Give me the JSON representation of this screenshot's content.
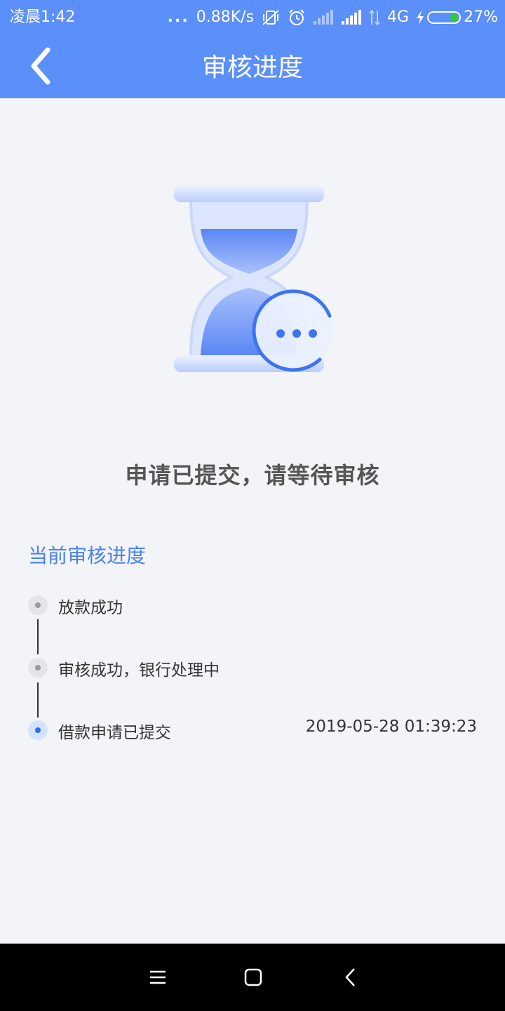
{
  "status_bar": {
    "time": "凌晨1:42",
    "dots": "...",
    "net_speed": "0.88K/s",
    "network": "4G",
    "battery": "27%",
    "battery_level": 0.27
  },
  "header": {
    "title": "审核进度",
    "background_color": "#5b8ff9"
  },
  "illustration": {
    "icon": "hourglass-icon",
    "badge_icon": "ellipsis-icon"
  },
  "main": {
    "message": "申请已提交，请等待审核",
    "progress_heading": "当前审核进度",
    "accent_color": "#4a82f5",
    "steps": [
      {
        "label": "放款成功",
        "time": "",
        "active": false
      },
      {
        "label": "审核成功，银行处理中",
        "time": "",
        "active": false
      },
      {
        "label": "借款申请已提交",
        "time": "2019-05-28 01:39:23",
        "active": true
      }
    ]
  },
  "nav_bar": {
    "icons": [
      "menu-icon",
      "home-icon",
      "back-icon"
    ]
  }
}
